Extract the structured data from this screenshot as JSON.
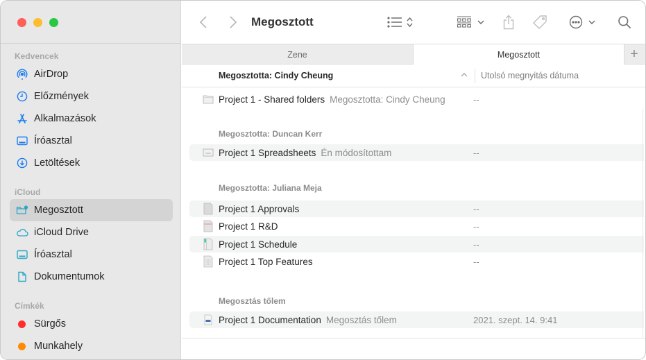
{
  "window": {
    "traffic_lights": [
      "#ff5f57",
      "#febc2e",
      "#28c840"
    ]
  },
  "sidebar": {
    "sections": [
      {
        "title": "Kedvencek",
        "items": [
          {
            "label": "AirDrop",
            "icon": "airdrop-icon"
          },
          {
            "label": "Előzmények",
            "icon": "clock-icon"
          },
          {
            "label": "Alkalmazások",
            "icon": "applications-icon"
          },
          {
            "label": "Íróasztal",
            "icon": "desktop-icon"
          },
          {
            "label": "Letöltések",
            "icon": "download-icon"
          }
        ]
      },
      {
        "title": "iCloud",
        "items": [
          {
            "label": "Megosztott",
            "icon": "shared-folder-icon",
            "selected": true
          },
          {
            "label": "iCloud Drive",
            "icon": "cloud-icon"
          },
          {
            "label": "Íróasztal",
            "icon": "desktop-icon"
          },
          {
            "label": "Dokumentumok",
            "icon": "document-icon"
          }
        ]
      },
      {
        "title": "Címkék",
        "items": [
          {
            "label": "Sürgős",
            "color": "#ff2d2d"
          },
          {
            "label": "Munkahely",
            "color": "#ff8a00"
          }
        ]
      }
    ],
    "accent_blue": "#1a7cf2",
    "accent_teal": "#2aa7c6"
  },
  "toolbar": {
    "title": "Megosztott",
    "back_icon": "chevron-left-icon",
    "forward_icon": "chevron-right-icon",
    "view_icon": "list-view-icon",
    "group_icon": "icon-grid-icon",
    "share_icon": "share-icon",
    "tag_icon": "tag-icon",
    "more_icon": "ellipsis-circle-icon",
    "search_icon": "search-icon"
  },
  "tabs": [
    {
      "label": "Zene",
      "active": false
    },
    {
      "label": "Megosztott",
      "active": true
    }
  ],
  "tab_add_label": "+",
  "columns": {
    "name": "Megosztotta: Cindy Cheung",
    "date": "Utolsó megnyitás dátuma",
    "sort": "ascending"
  },
  "groups": [
    {
      "title": "",
      "rows": [
        {
          "name": "Project 1 - Shared folders",
          "meta": "Megosztotta: Cindy Cheung",
          "date": "--",
          "icon": "folder-doc"
        }
      ]
    },
    {
      "title": "Megosztotta: Duncan Kerr",
      "rows": [
        {
          "name": "Project 1 Spreadsheets",
          "meta": "Én módosítottam",
          "date": "--",
          "icon": "spreadsheet-doc"
        }
      ]
    },
    {
      "title": "Megosztotta: Juliana Meja",
      "rows": [
        {
          "name": "Project 1 Approvals",
          "meta": "",
          "date": "--",
          "icon": "plain-doc"
        },
        {
          "name": "Project 1 R&D",
          "meta": "",
          "date": "--",
          "icon": "red-doc"
        },
        {
          "name": "Project 1 Schedule",
          "meta": "",
          "date": "--",
          "icon": "teal-doc"
        },
        {
          "name": "Project 1 Top Features",
          "meta": "",
          "date": "--",
          "icon": "table-doc"
        }
      ]
    },
    {
      "title": "Megosztás tőlem",
      "rows": [
        {
          "name": "Project 1 Documentation",
          "meta": "Megosztás tőlem",
          "date": "2021. szept. 14. 9:41",
          "icon": "blue-doc"
        }
      ]
    }
  ]
}
